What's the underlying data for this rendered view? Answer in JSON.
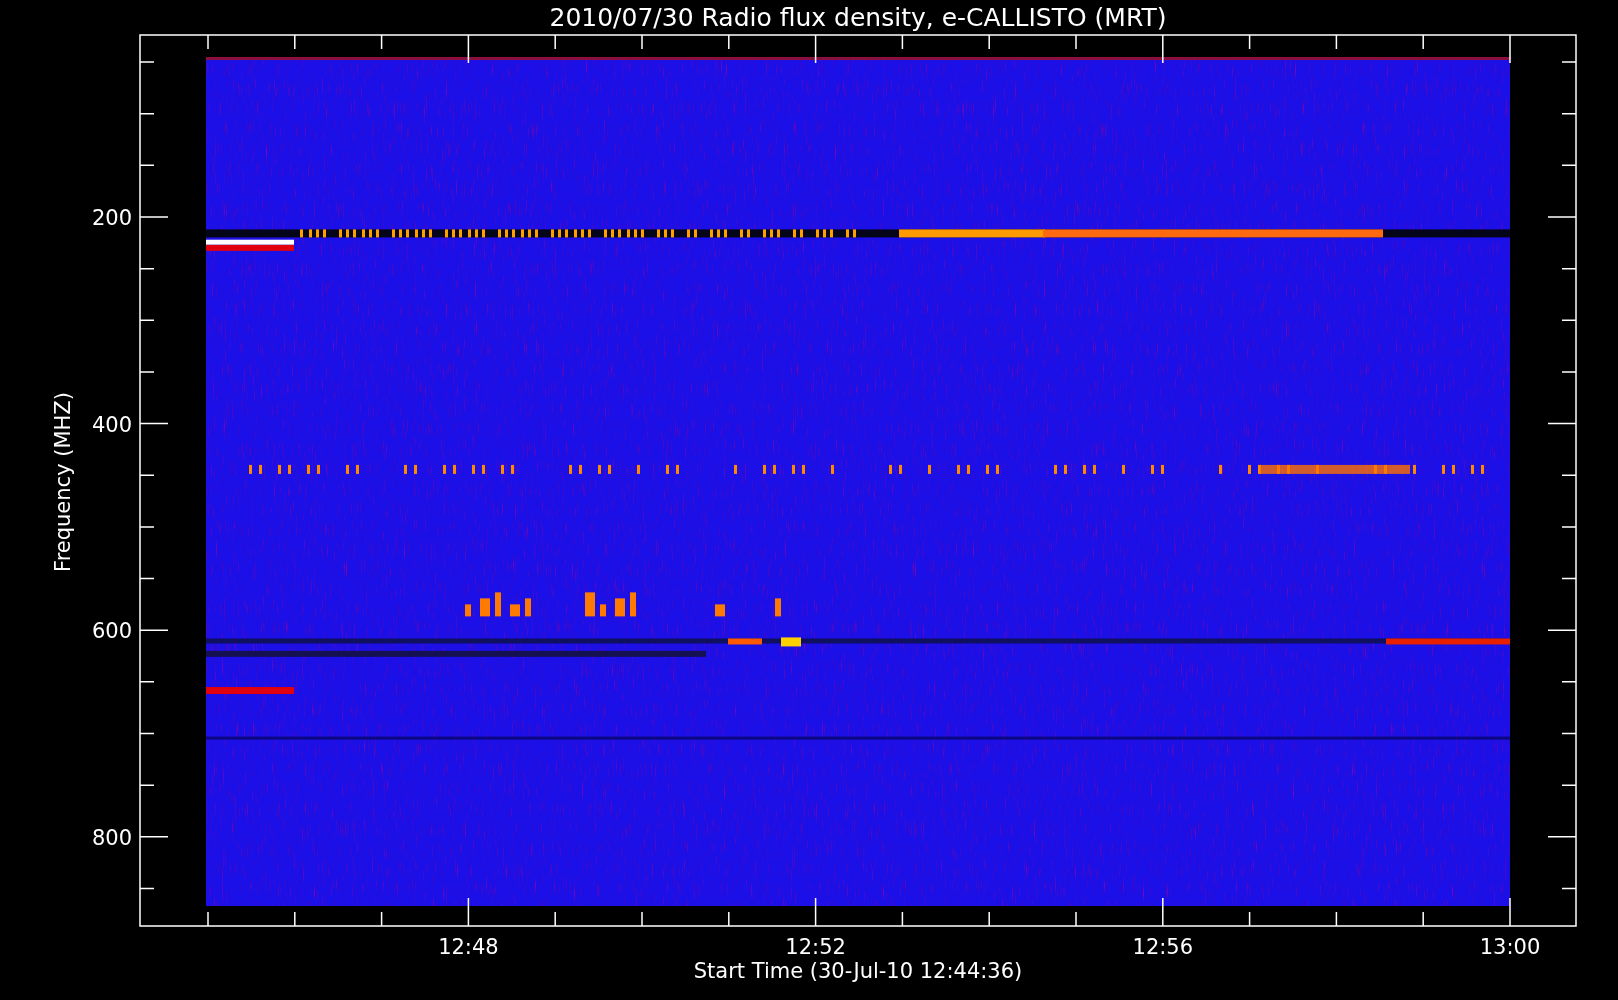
{
  "title": "2010/07/30  Radio flux density, e-CALLISTO (MRT)",
  "y_axis": {
    "label": "Frequency (MHZ)",
    "tick_labels": [
      "200",
      "400",
      "600",
      "800"
    ]
  },
  "x_axis": {
    "label": "Start Time (30-Jul-10 12:44:36)",
    "tick_labels": [
      "12:48",
      "12:52",
      "12:56",
      "13:00"
    ]
  }
}
